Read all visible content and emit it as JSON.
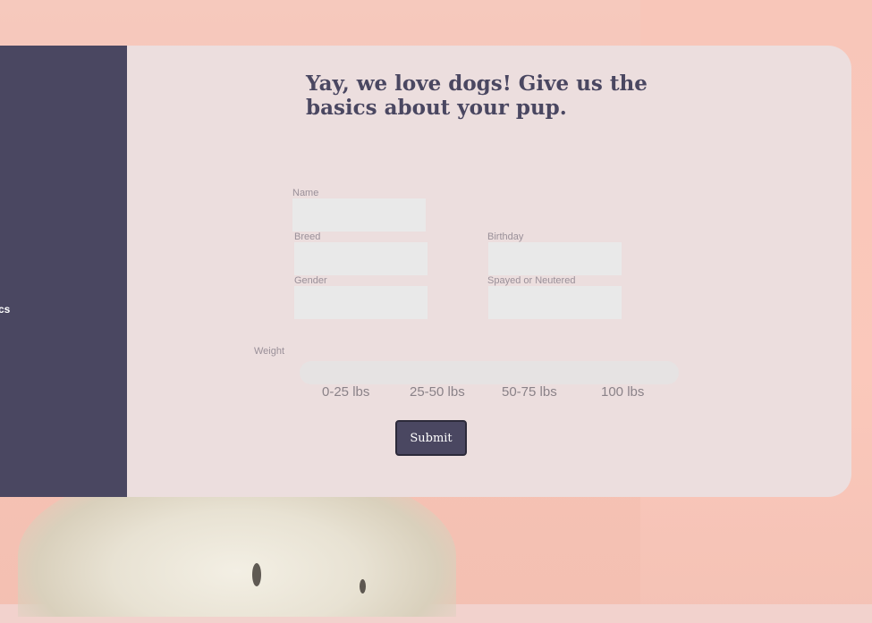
{
  "sidebar": {
    "label": "cs"
  },
  "form": {
    "title": "Yay, we love dogs! Give us the basics about your pup.",
    "fields": {
      "name": {
        "label": "Name",
        "value": ""
      },
      "breed": {
        "label": "Breed",
        "value": ""
      },
      "birthday": {
        "label": "Birthday",
        "value": ""
      },
      "gender": {
        "label": "Gender",
        "value": ""
      },
      "spayed": {
        "label": "Spayed or Neutered",
        "value": ""
      }
    },
    "weight": {
      "label": "Weight",
      "options": [
        "0-25 lbs",
        "25-50 lbs",
        "50-75 lbs",
        "100 lbs"
      ]
    },
    "submit_label": "Submit"
  },
  "colors": {
    "accent": "#4a4761",
    "panel": "#ecdede",
    "background": "#f6c9bd",
    "input": "#e9e9e9"
  }
}
